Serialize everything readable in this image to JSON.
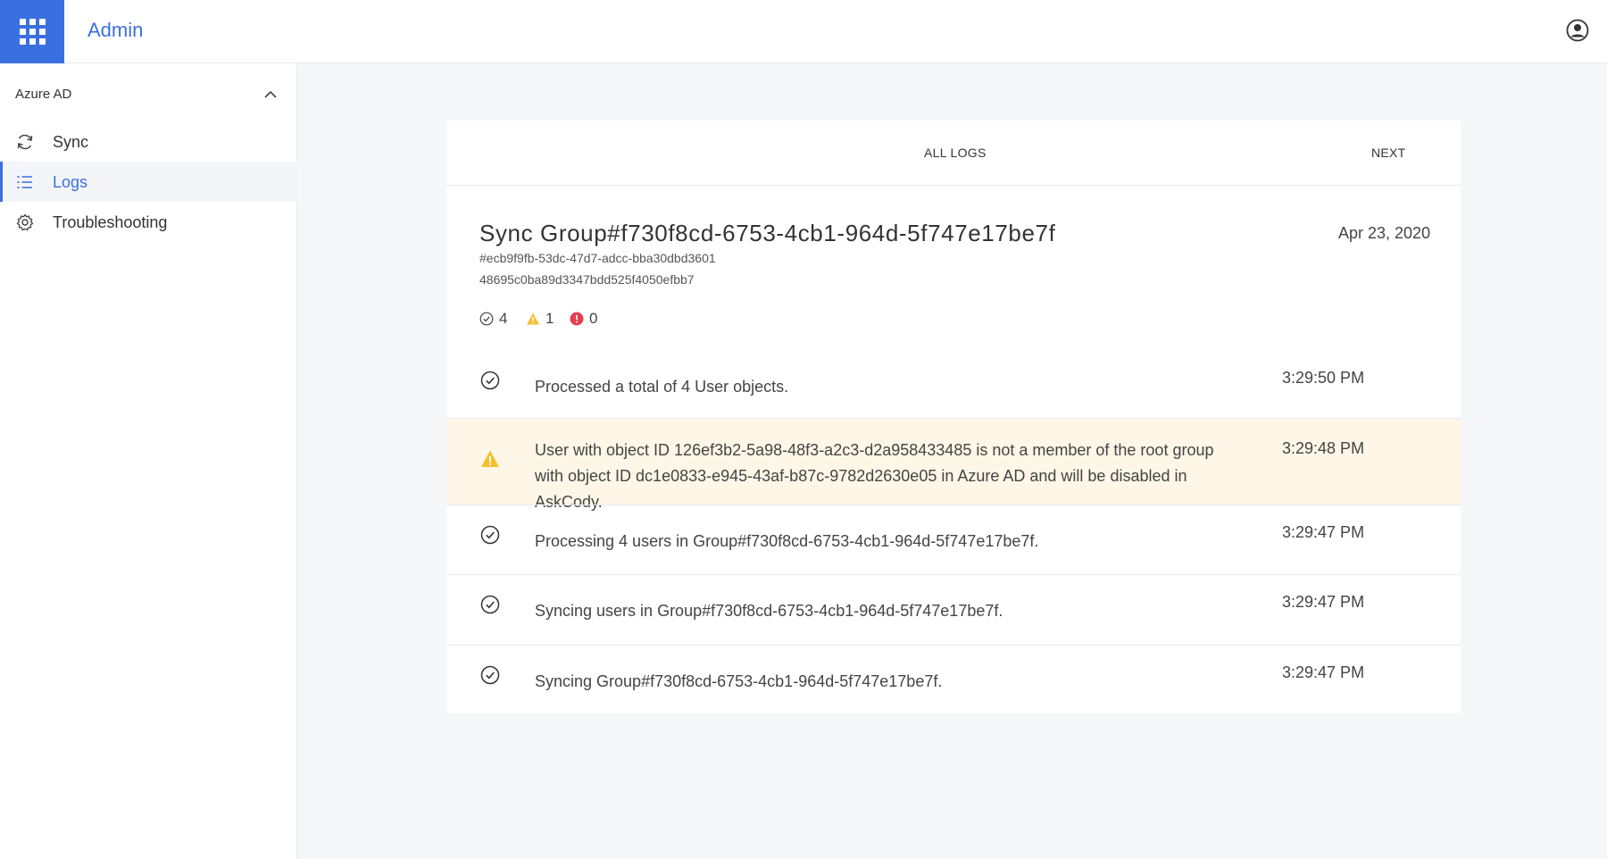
{
  "app": {
    "title": "Admin"
  },
  "sidebar": {
    "section": "Azure AD",
    "items": [
      {
        "label": "Sync",
        "icon": "sync-icon"
      },
      {
        "label": "Logs",
        "icon": "list-icon",
        "active": true
      },
      {
        "label": "Troubleshooting",
        "icon": "gear-icon"
      }
    ]
  },
  "tabs": {
    "all_logs": "ALL LOGS",
    "next": "NEXT"
  },
  "log": {
    "title": "Sync Group#f730f8cd-6753-4cb1-964d-5f747e17be7f",
    "id1": "#ecb9f9fb-53dc-47d7-adcc-bba30dbd3601",
    "id2": "48695c0ba89d3347bdd525f4050efbb7",
    "date": "Apr 23, 2020",
    "counts": {
      "success": "4",
      "warning": "1",
      "error": "0"
    },
    "entries": [
      {
        "type": "success",
        "text": "Processed a total of 4 User objects.",
        "time": "3:29:50 PM"
      },
      {
        "type": "warning",
        "text": "User with object ID 126ef3b2-5a98-48f3-a2c3-d2a958433485 is not a member of the root group with object ID dc1e0833-e945-43af-b87c-9782d2630e05 in Azure AD and will be disabled in AskCody.",
        "time": "3:29:48 PM"
      },
      {
        "type": "success",
        "text": "Processing 4 users in Group#f730f8cd-6753-4cb1-964d-5f747e17be7f.",
        "time": "3:29:47 PM"
      },
      {
        "type": "success",
        "text": "Syncing users in Group#f730f8cd-6753-4cb1-964d-5f747e17be7f.",
        "time": "3:29:47 PM"
      },
      {
        "type": "success",
        "text": "Syncing Group#f730f8cd-6753-4cb1-964d-5f747e17be7f.",
        "time": "3:29:47 PM"
      }
    ]
  },
  "colors": {
    "accent": "#3a6fe0",
    "warning": "#f5c030",
    "error": "#e04050",
    "warning_bg": "#fef7e7"
  }
}
